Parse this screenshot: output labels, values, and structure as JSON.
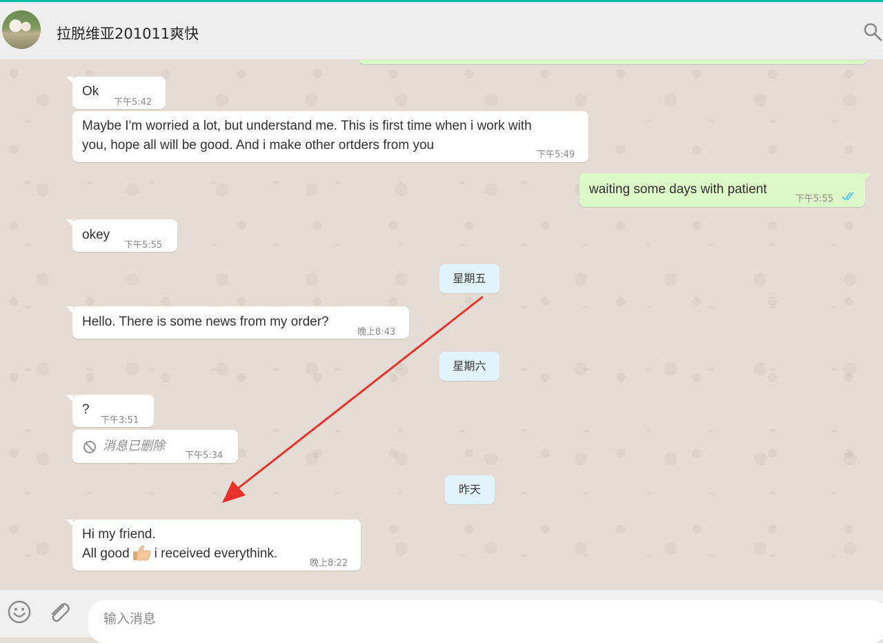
{
  "header": {
    "contact_name": "拉脱维亚201011爽快",
    "avatar_icon": "contact-avatar",
    "search_icon": "search-icon"
  },
  "colors": {
    "incoming_bubble": "#ffffff",
    "outgoing_bubble": "#dcf8c6",
    "day_chip": "#e1f3fb",
    "read_ticks": "#4fc3f7",
    "annotation_arrow": "#e8322a",
    "accent_bar": "#00bfa5"
  },
  "messages": [
    {
      "direction": "incoming",
      "lines": [
        "Ok"
      ],
      "time": "下午5:42"
    },
    {
      "direction": "incoming",
      "lines": [
        "Maybe I'm worried a lot, but understand me. This is first time when i work with",
        "you, hope all will be good. And i make other ortders from you"
      ],
      "time": "下午5:49"
    },
    {
      "direction": "outgoing",
      "lines": [
        "waiting some days with patient"
      ],
      "time": "下午5:55",
      "status": "read"
    },
    {
      "direction": "incoming",
      "lines": [
        "okey"
      ],
      "time": "下午5:55"
    },
    {
      "day_divider": "星期五"
    },
    {
      "direction": "incoming",
      "lines": [
        "Hello. There is some news from my order?"
      ],
      "time": "晚上8:43"
    },
    {
      "day_divider": "星期六"
    },
    {
      "direction": "incoming",
      "lines": [
        "?"
      ],
      "time": "下午3:51"
    },
    {
      "direction": "incoming",
      "deleted": true,
      "text": "消息已删除",
      "time": "下午5:34"
    },
    {
      "day_divider": "昨天"
    },
    {
      "direction": "incoming",
      "lines": [
        "Hi my friend.",
        "All good",
        "i received everythink."
      ],
      "emoji": "thumbs-up",
      "time": "晚上8:22"
    }
  ],
  "footer": {
    "input_placeholder": "输入消息",
    "emoji_icon": "emoji-icon",
    "attach_icon": "paperclip-icon"
  },
  "annotation": {
    "type": "red-arrow",
    "from": "星期五",
    "to": "Hi my friend."
  }
}
